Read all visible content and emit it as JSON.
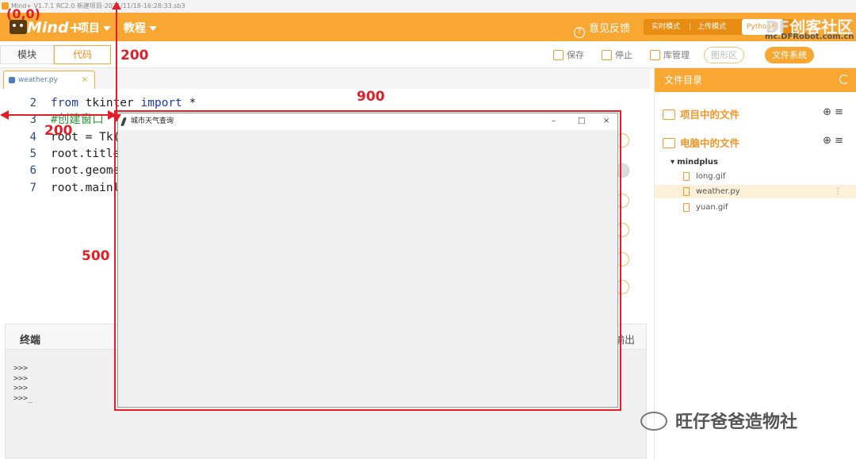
{
  "window": {
    "title": "Mind+ V1.7.1 RC2.0   新建项目-2021/11/18-16:28:33.sb3"
  },
  "header": {
    "logo_text": "Mind+",
    "menu_project": "项目",
    "menu_tutorial": "教程",
    "feedback": "意见反馈",
    "mode_realtime": "实时模式",
    "mode_upload": "上传模式",
    "mode_python": "Python模",
    "brand": "创客社区",
    "brand_df": "DF",
    "brand_sub": "mc.DFRobot.com.cn"
  },
  "toolbar": {
    "tab_blocks": "模块",
    "tab_code": "代码",
    "save": "保存",
    "stop": "停止",
    "library": "库管理",
    "graphics": "图形区",
    "filesystem": "文件系统"
  },
  "editor": {
    "tab_name": "weather.py",
    "close": "×",
    "lines": [
      {
        "n": "2",
        "parts": [
          {
            "t": "from",
            "c": "kw"
          },
          {
            "t": " tkinter ",
            "c": ""
          },
          {
            "t": "import",
            "c": "kw"
          },
          {
            "t": " *",
            "c": ""
          }
        ]
      },
      {
        "n": "3",
        "parts": [
          {
            "t": "#创建窗口",
            "c": "cm"
          }
        ]
      },
      {
        "n": "4",
        "parts": [
          {
            "t": "root = Tk()",
            "c": ""
          }
        ]
      },
      {
        "n": "5",
        "parts": [
          {
            "t": "root.title",
            "c": ""
          }
        ]
      },
      {
        "n": "6",
        "parts": [
          {
            "t": "root.geome",
            "c": ""
          }
        ]
      },
      {
        "n": "7",
        "parts": [
          {
            "t": "root.mainl",
            "c": ""
          }
        ]
      }
    ]
  },
  "terminal": {
    "title": "终端",
    "output_label": "输出",
    "lines": [
      ">>>",
      ">>>",
      ">>>",
      ">>>_"
    ]
  },
  "files": {
    "header": "文件目录",
    "project_files": "项目中的文件",
    "computer_files": "电脑中的文件",
    "folder": "mindplus",
    "items": [
      "long.gif",
      "weather.py",
      "yuan.gif"
    ]
  },
  "popup": {
    "title": "城市天气查询",
    "minimize": "–",
    "maximize": "□",
    "close": "×"
  },
  "annotations": {
    "origin": "(0,0)",
    "top_offset": "200",
    "left_offset": "200",
    "width": "900",
    "height": "500"
  },
  "watermark": "旺仔爸爸造物社",
  "colors": {
    "accent": "#f8a733",
    "annotation": "#e21f26"
  }
}
